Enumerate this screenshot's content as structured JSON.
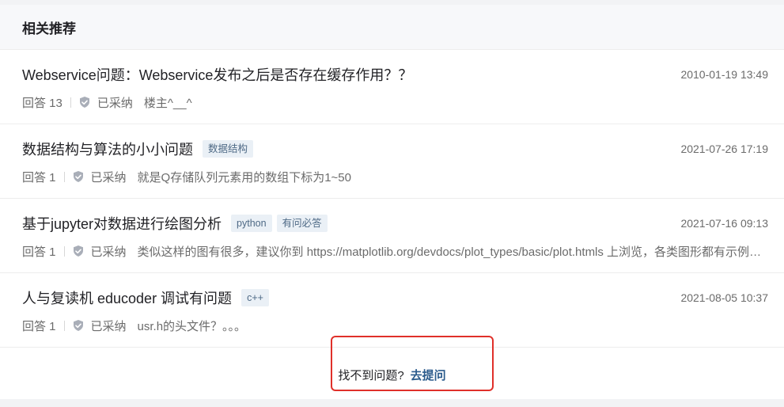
{
  "header": {
    "title": "相关推荐"
  },
  "items": [
    {
      "title": "Webservice问题：Webservice发布之后是否存在缓存作用？？",
      "tags": [],
      "date": "2010-01-19 13:49",
      "answers": "回答 13",
      "status": "已采纳",
      "answer_text": "楼主^__^"
    },
    {
      "title": "数据结构与算法的小小问题",
      "tags": [
        "数据结构"
      ],
      "date": "2021-07-26 17:19",
      "answers": "回答 1",
      "status": "已采纳",
      "answer_text": "就是Q存储队列元素用的数组下标为1~50"
    },
    {
      "title": "基于jupyter对数据进行绘图分析",
      "tags": [
        "python",
        "有问必答"
      ],
      "date": "2021-07-16 09:13",
      "answers": "回答 1",
      "status": "已采纳",
      "answer_text": "类似这样的图有很多，建议你到 https://matplotlib.org/devdocs/plot_types/basic/plot.htmls 上浏览，各类图形都有示例和代码"
    },
    {
      "title": "人与复读机 educoder 调试有问题",
      "tags": [
        "c++"
      ],
      "date": "2021-08-05 10:37",
      "answers": "回答 1",
      "status": "已采纳",
      "answer_text": "usr.h的头文件？。。。"
    }
  ],
  "footer": {
    "prompt": "找不到问题?",
    "link": "去提问"
  },
  "colors": {
    "link": "#2b5b8c",
    "highlight": "#e0302a",
    "tag_bg": "#eaf0f6",
    "tag_text": "#4f6a86"
  },
  "icons": {
    "accepted": "shield-check-icon"
  }
}
